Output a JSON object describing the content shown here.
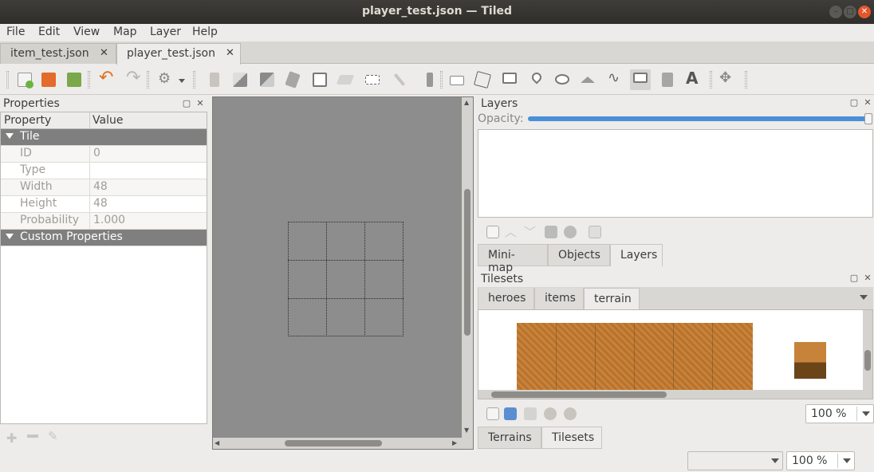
{
  "window": {
    "title": "player_test.json — Tiled"
  },
  "menu": [
    "File",
    "Edit",
    "View",
    "Map",
    "Layer",
    "Help"
  ],
  "doc_tabs": [
    {
      "label": "item_test.json",
      "active": false
    },
    {
      "label": "player_test.json",
      "active": true
    }
  ],
  "toolbar": {
    "icons": [
      "new-map-icon",
      "open-icon",
      "save-icon",
      "undo-icon",
      "redo-icon",
      "commands-icon",
      "stamp-brush-icon",
      "terrain-brush-icon",
      "wang-brush-icon",
      "bucket-fill-icon",
      "shape-fill-icon",
      "eraser-icon",
      "rect-select-icon",
      "magic-wand-icon",
      "select-same-tile-icon",
      "select-objects-icon",
      "edit-polygons-icon",
      "insert-rectangle-icon",
      "insert-point-icon",
      "insert-ellipse-icon",
      "insert-polygon-icon",
      "insert-polyline-icon",
      "insert-tile-icon",
      "insert-template-icon",
      "insert-text-icon",
      "random-mode-icon"
    ]
  },
  "properties_panel": {
    "title": "Properties",
    "col_property": "Property",
    "col_value": "Value",
    "section_tile": "Tile",
    "rows": [
      {
        "key": "ID",
        "value": "0"
      },
      {
        "key": "Type",
        "value": ""
      },
      {
        "key": "Width",
        "value": "48"
      },
      {
        "key": "Height",
        "value": "48"
      },
      {
        "key": "Probability",
        "value": "1.000"
      }
    ],
    "section_custom": "Custom Properties"
  },
  "layers_panel": {
    "title": "Layers",
    "opacity_label": "Opacity:",
    "opacity": 1.0,
    "tabs": [
      {
        "label": "Mini-map",
        "selected": false
      },
      {
        "label": "Objects",
        "selected": false
      },
      {
        "label": "Layers",
        "selected": true
      }
    ]
  },
  "tilesets_panel": {
    "title": "Tilesets",
    "tabs": [
      {
        "label": "heroes",
        "selected": false
      },
      {
        "label": "items",
        "selected": false
      },
      {
        "label": "terrain",
        "selected": true
      }
    ],
    "zoom": "100 %",
    "bottom_tabs": [
      {
        "label": "Terrains",
        "selected": false
      },
      {
        "label": "Tilesets",
        "selected": true
      }
    ]
  },
  "statusbar": {
    "layer_combo": "",
    "zoom": "100 %"
  },
  "colors": {
    "titlebar": "#2f2e2a",
    "close_button": "#e4572e",
    "selection_accent": "#4a90d9",
    "section_header": "#7f7f7f"
  }
}
